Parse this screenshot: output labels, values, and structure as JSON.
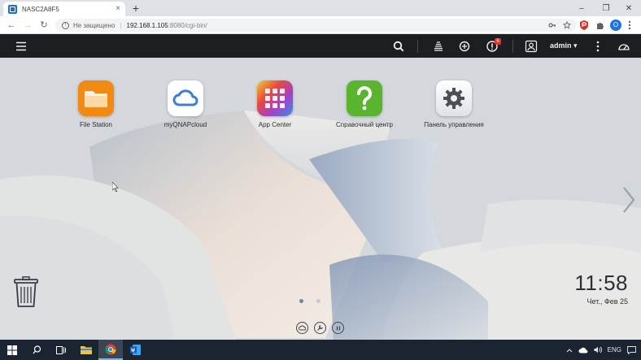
{
  "browser": {
    "tab_title": "NASC2A8F5",
    "tab_close": "×",
    "new_tab": "+",
    "win_min": "–",
    "win_max": "❐",
    "win_close": "✕",
    "back": "←",
    "forward": "→",
    "reload": "↻",
    "security_icon": "!",
    "security_text": "Не защищено",
    "separator": "|",
    "url_host": "192.168.1.105",
    "url_path": ":8080/cgi-bin/",
    "profile_initial": "О"
  },
  "qnap_bar": {
    "user": "admin",
    "user_caret": "▾",
    "notification_count": "6"
  },
  "apps": [
    {
      "label": "File Station",
      "icon": "folder-icon"
    },
    {
      "label": "myQNAPcloud",
      "icon": "cloud-icon"
    },
    {
      "label": "App Center",
      "icon": "app-grid-icon"
    },
    {
      "label": "Справочный центр",
      "icon": "question-icon"
    },
    {
      "label": "Панель управления",
      "icon": "gear-icon"
    }
  ],
  "clock": {
    "time": "11:58",
    "date": "Чет., Фев 25"
  },
  "taskbar": {
    "language": "ENG"
  },
  "colors": {
    "qnap_bar": "#1d1e22",
    "file_station": "#f28a12",
    "help_center": "#5ab52e",
    "taskbar": "#1b2431"
  }
}
